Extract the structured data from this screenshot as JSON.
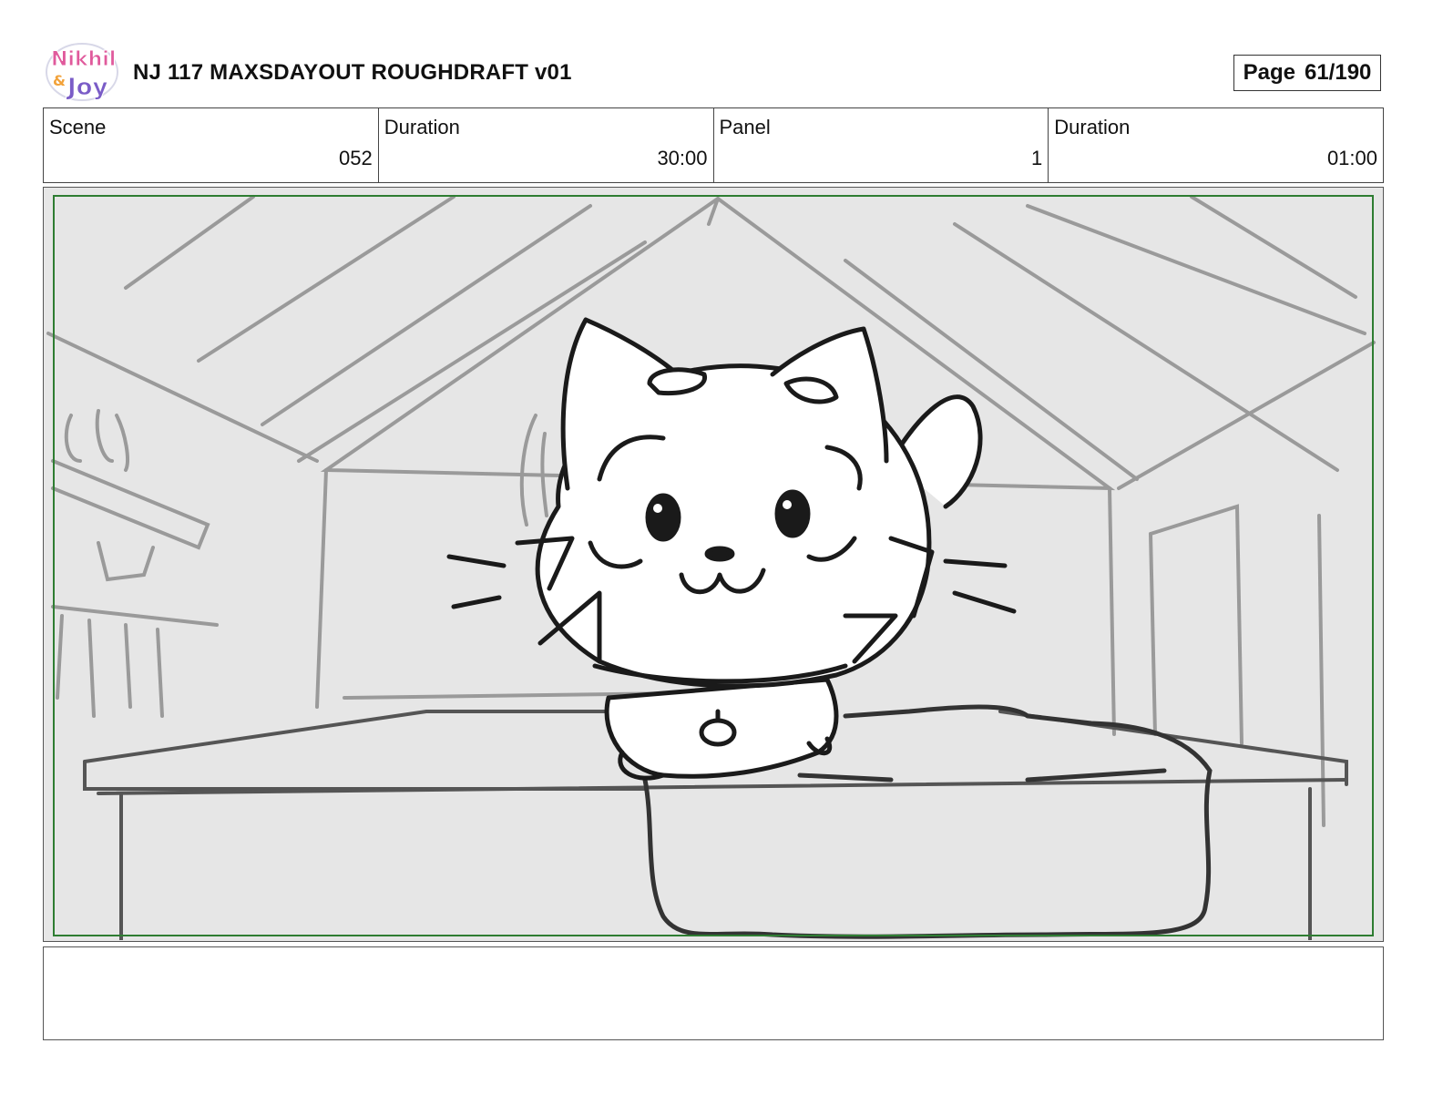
{
  "header": {
    "logo_text_top": "Nikhil",
    "logo_text_amp": "&",
    "logo_text_bottom": "Joy",
    "title": "NJ 117 MAXSDAYOUT ROUGHDRAFT v01",
    "page_label": "Page",
    "page_value": "61/190"
  },
  "info": [
    {
      "label": "Scene",
      "value": "052"
    },
    {
      "label": "Duration",
      "value": "30:00"
    },
    {
      "label": "Panel",
      "value": "1"
    },
    {
      "label": "Duration",
      "value": "01:00"
    }
  ],
  "colors": {
    "safe_frame": "#2e7d32",
    "panel_bg": "#e6e6e6",
    "background_lines": "#9a9a9a",
    "ink": "#1a1a1a",
    "logo_pink": "#e05a9c",
    "logo_purple": "#7a5cc7",
    "logo_orange": "#f2a23a"
  },
  "notes": {
    "action_text": ""
  }
}
